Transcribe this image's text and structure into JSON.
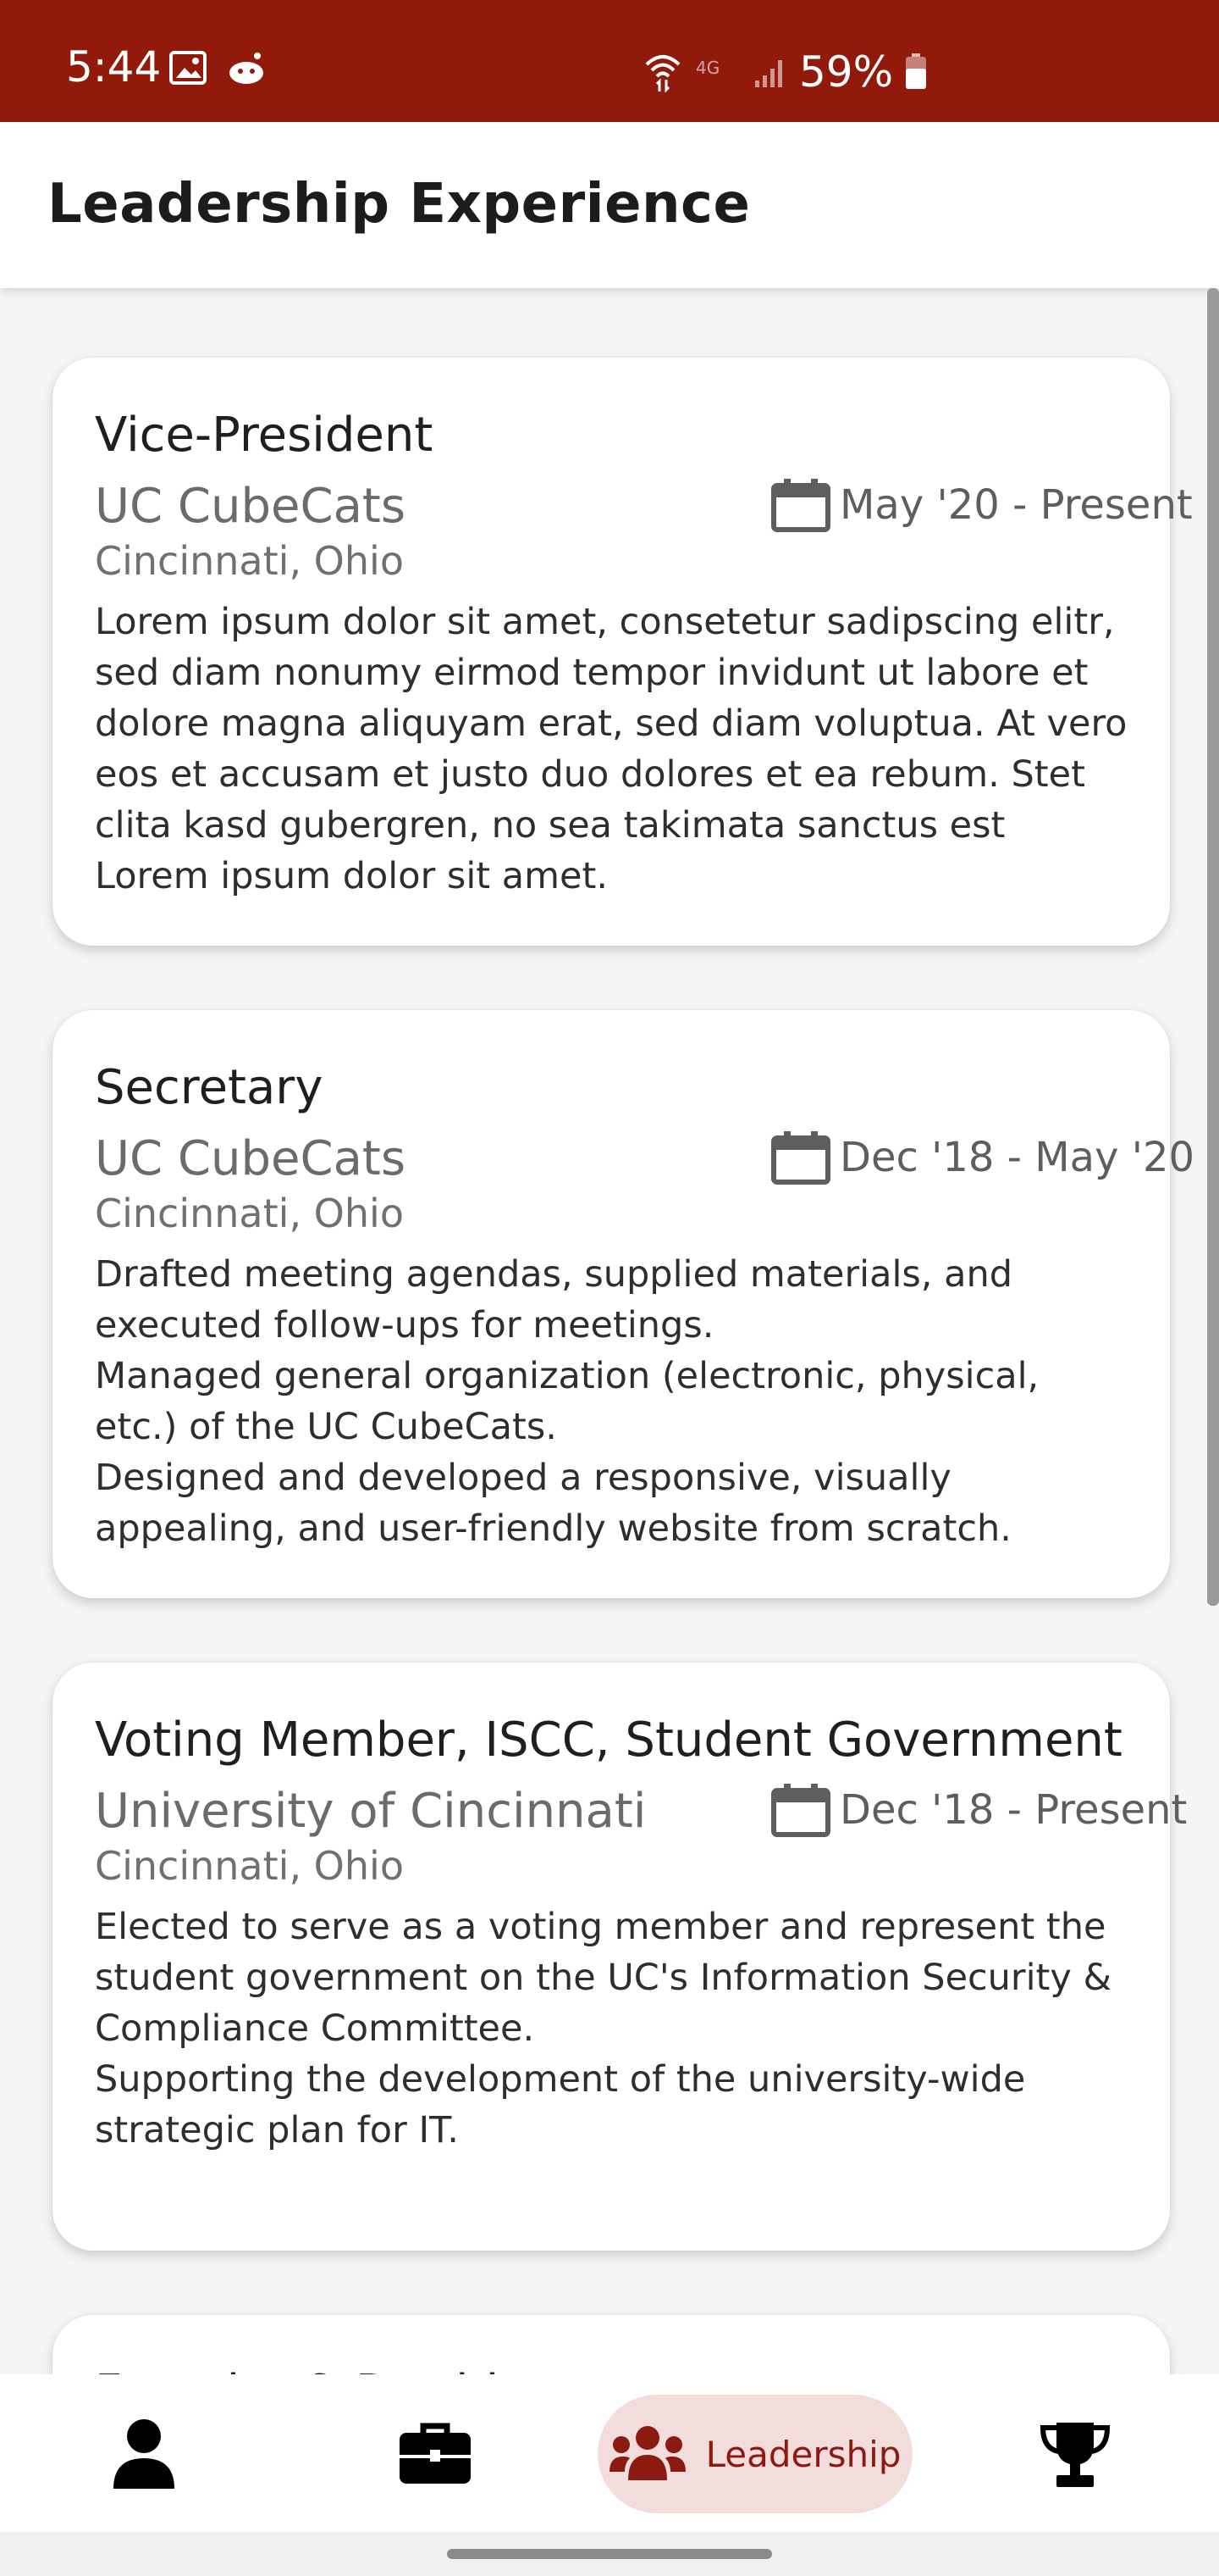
{
  "status_bar": {
    "time": "5:44",
    "battery": "59%",
    "network": "4G",
    "background_color": "#921a0b"
  },
  "app_bar": {
    "title": "Leadership Experience"
  },
  "cards": [
    {
      "title": "Vice-President",
      "organization": "UC CubeCats",
      "date": "May '20 - Present",
      "location": "Cincinnati, Ohio",
      "description": "Lorem ipsum dolor sit amet, consetetur sadipscing elitr, sed diam nonumy eirmod tempor invidunt ut labore et dolore magna aliquyam erat, sed diam voluptua. At vero eos et accusam et justo duo dolores et ea rebum. Stet clita kasd gubergren, no sea takimata sanctus est Lorem ipsum dolor sit amet."
    },
    {
      "title": "Secretary",
      "organization": "UC CubeCats",
      "date": "Dec '18 - May '20",
      "location": "Cincinnati, Ohio",
      "description": "Drafted meeting agendas, supplied materials, and executed follow-ups for meetings.\nManaged general organization (electronic, physical, etc.) of the UC CubeCats.\nDesigned and developed a responsive, visually appealing, and user-friendly website from scratch."
    },
    {
      "title": "Voting Member, ISCC, Student Government",
      "organization": "University of Cincinnati",
      "date": "Dec '18 - Present",
      "location": "Cincinnati, Ohio",
      "description": "Elected to serve as a voting member and represent the student government on the UC's Information Security & Compliance Committee.\nSupporting the development of the university-wide strategic plan for IT."
    },
    {
      "title": "Founder & President"
    }
  ],
  "bottom_nav": {
    "items": [
      {
        "icon": "person-icon"
      },
      {
        "icon": "briefcase-icon"
      },
      {
        "icon": "users-icon",
        "label": "Leadership",
        "active": true
      },
      {
        "icon": "trophy-icon"
      }
    ],
    "active_color": "#8b1a10",
    "active_background": "#f3dcdc"
  }
}
